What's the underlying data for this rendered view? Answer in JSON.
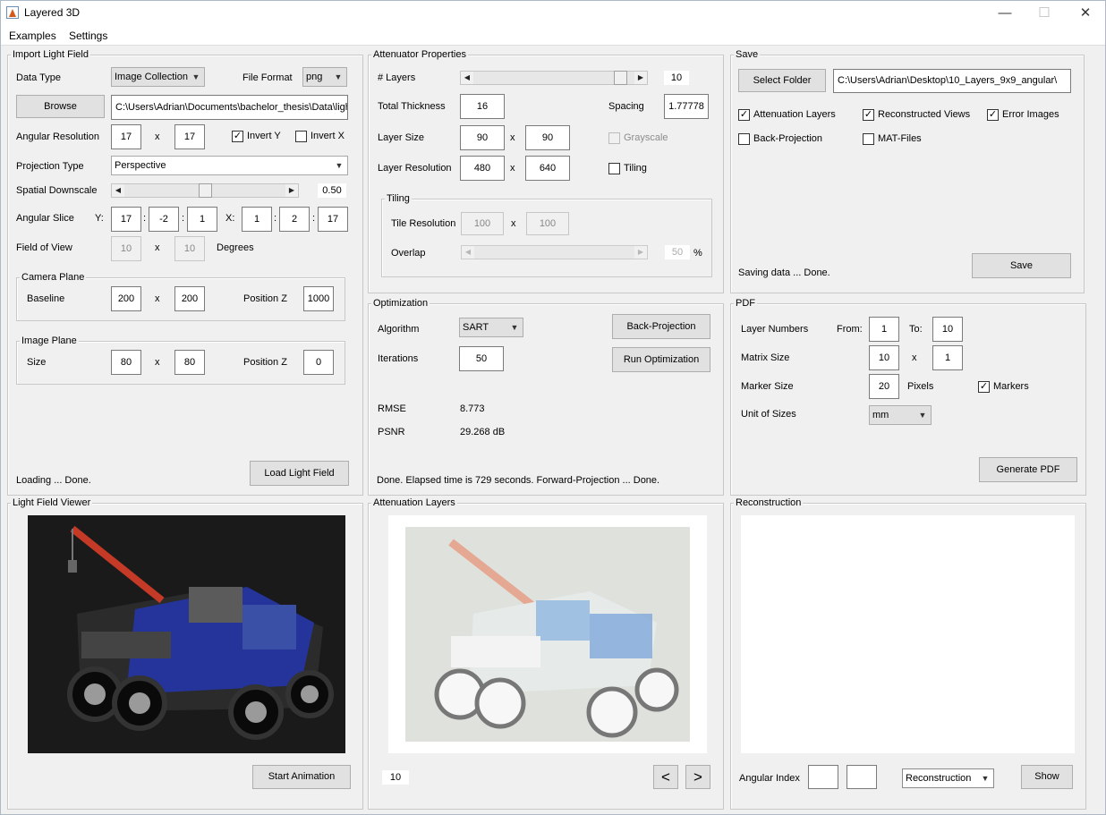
{
  "window": {
    "title": "Layered 3D",
    "minimize": "—",
    "maximize": "☐",
    "close": "✕"
  },
  "menu": [
    "Examples",
    "Settings"
  ],
  "import": {
    "title": "Import Light Field",
    "data_type_label": "Data Type",
    "data_type_value": "Image Collection",
    "file_format_label": "File Format",
    "file_format_value": "png",
    "browse": "Browse",
    "path": "C:\\Users\\Adrian\\Documents\\bachelor_thesis\\Data\\light",
    "angular_res_label": "Angular Resolution",
    "angular_res_x": "17",
    "angular_res_y": "17",
    "x_sep": "x",
    "invert_y": "Invert Y",
    "invert_x": "Invert X",
    "projection_type_label": "Projection Type",
    "projection_type_value": "Perspective",
    "spatial_downscale_label": "Spatial Downscale",
    "spatial_downscale_value": "0.50",
    "spatial_downscale_fraction": 0.5,
    "angular_slice_label": "Angular Slice",
    "y_label": "Y:",
    "x_label": "X:",
    "colon": ":",
    "slice_y": [
      "17",
      "-2",
      "1"
    ],
    "slice_x": [
      "1",
      "2",
      "17"
    ],
    "fov_label": "Field of View",
    "fov_x": "10",
    "fov_y": "10",
    "degrees": "Degrees",
    "camera_plane_title": "Camera Plane",
    "baseline_label": "Baseline",
    "baseline_x": "200",
    "baseline_y": "200",
    "position_z_label": "Position Z",
    "camera_z": "1000",
    "image_plane_title": "Image Plane",
    "size_label": "Size",
    "size_x": "80",
    "size_y": "80",
    "image_z": "0",
    "status": "Loading ... Done.",
    "load_button": "Load Light Field"
  },
  "attenuator": {
    "title": "Attenuator Properties",
    "layers_label": "# Layers",
    "layers_value": "10",
    "layers_fraction": 0.95,
    "thickness_label": "Total Thickness",
    "thickness_value": "16",
    "spacing_label": "Spacing",
    "spacing_value": "1.77778",
    "layer_size_label": "Layer Size",
    "layer_size_x": "90",
    "layer_size_y": "90",
    "grayscale": "Grayscale",
    "layer_res_label": "Layer Resolution",
    "layer_res_x": "480",
    "layer_res_y": "640",
    "tiling_cb": "Tiling",
    "tiling_title": "Tiling",
    "tile_res_label": "Tile Resolution",
    "tile_res_x": "100",
    "tile_res_y": "100",
    "overlap_label": "Overlap",
    "overlap_value": "50",
    "percent": "%"
  },
  "optimization": {
    "title": "Optimization",
    "algorithm_label": "Algorithm",
    "algorithm_value": "SART",
    "back_projection": "Back-Projection",
    "iterations_label": "Iterations",
    "iterations_value": "50",
    "run": "Run Optimization",
    "rmse_label": "RMSE",
    "rmse_value": "8.773",
    "psnr_label": "PSNR",
    "psnr_value": "29.268 dB",
    "status": "Done. Elapsed time is 729 seconds. Forward-Projection ... Done."
  },
  "save": {
    "title": "Save",
    "select_folder": "Select Folder",
    "folder_path": "C:\\Users\\Adrian\\Desktop\\10_Layers_9x9_angular\\",
    "attenuation_layers": "Attenuation Layers",
    "reconstructed_views": "Reconstructed Views",
    "error_images": "Error Images",
    "back_projection": "Back-Projection",
    "mat_files": "MAT-Files",
    "status": "Saving data ... Done.",
    "save_button": "Save"
  },
  "pdf": {
    "title": "PDF",
    "layer_numbers_label": "Layer Numbers",
    "from_label": "From:",
    "from_value": "1",
    "to_label": "To:",
    "to_value": "10",
    "matrix_size_label": "Matrix Size",
    "matrix_x": "10",
    "matrix_y": "1",
    "marker_size_label": "Marker Size",
    "marker_size_value": "20",
    "pixels": "Pixels",
    "markers": "Markers",
    "unit_label": "Unit of Sizes",
    "unit_value": "mm",
    "generate": "Generate PDF"
  },
  "viewer": {
    "title": "Light Field Viewer",
    "start": "Start Animation"
  },
  "layers_view": {
    "title": "Attenuation Layers",
    "index": "10",
    "prev": "<",
    "next": ">"
  },
  "reconstruction": {
    "title": "Reconstruction",
    "angular_index_label": "Angular Index",
    "mode_value": "Reconstruction",
    "show": "Show"
  }
}
